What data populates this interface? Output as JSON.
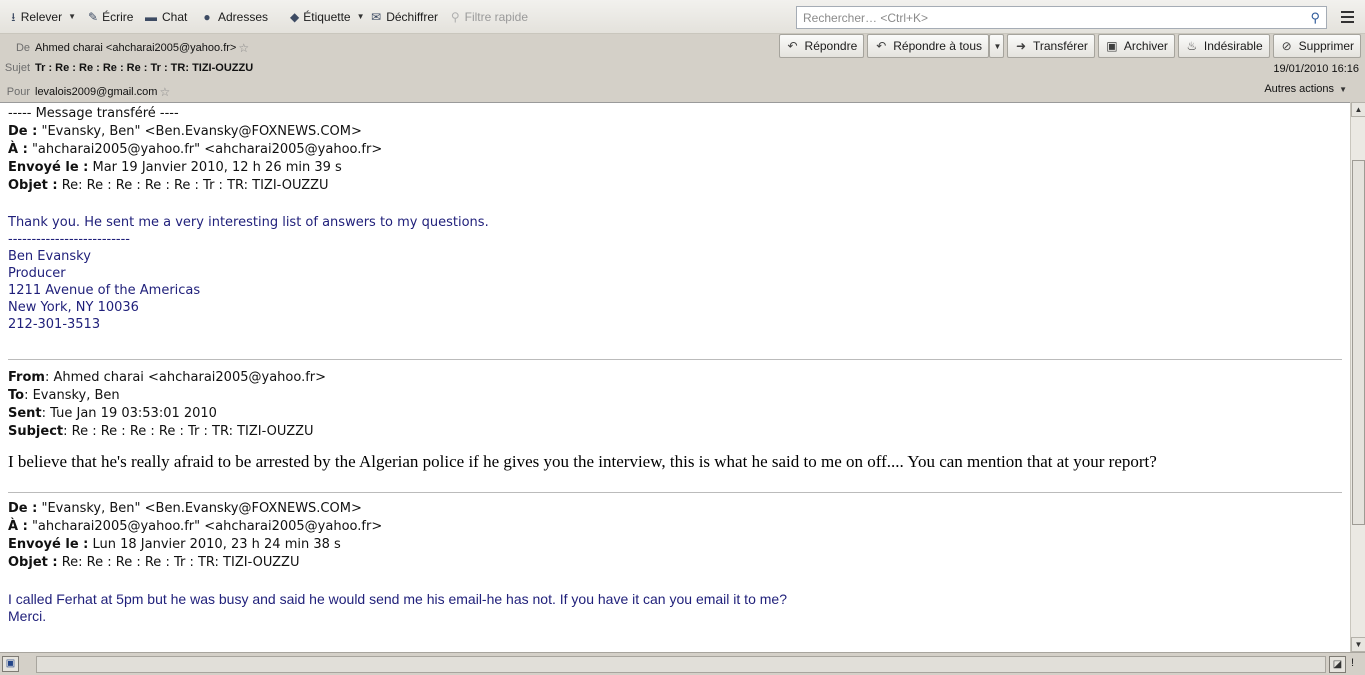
{
  "toolbar": {
    "relever": "Relever",
    "ecrire": "Écrire",
    "chat": "Chat",
    "adresses": "Adresses",
    "etiquette": "Étiquette",
    "dechiffrer": "Déchiffrer",
    "filtre": "Filtre rapide",
    "search_placeholder": "Rechercher… <Ctrl+K>"
  },
  "header": {
    "from_label": "De",
    "from_value": "Ahmed charai <ahcharai2005@yahoo.fr>",
    "subject_label": "Sujet",
    "subject_value": "Tr : Re : Re : Re : Re : Tr : TR: TIZI-OUZZU",
    "to_label": "Pour",
    "to_value": "levalois2009@gmail.com",
    "date": "19/01/2010 16:16",
    "other_actions": "Autres actions"
  },
  "actions": {
    "reply": "Répondre",
    "reply_all": "Répondre à tous",
    "forward": "Transférer",
    "archive": "Archiver",
    "junk": "Indésirable",
    "delete": "Supprimer"
  },
  "message": {
    "fwd_header": "----- Message transféré ----",
    "block1": {
      "de_label": "De :",
      "de_value": "\"Evansky, Ben\" <Ben.Evansky@FOXNEWS.COM>",
      "a_label": "À :",
      "a_value": "\"ahcharai2005@yahoo.fr\" <ahcharai2005@yahoo.fr>",
      "envoye_label": "Envoyé le :",
      "envoye_value": "Mar 19 Janvier 2010, 12 h 26 min 39 s",
      "objet_label": "Objet :",
      "objet_value": "Re: Re : Re : Re : Re : Tr : TR: TIZI-OUZZU"
    },
    "body1": "Thank you. He sent me a very interesting list of answers to my questions.",
    "sig_sep": "--------------------------",
    "signature": [
      "Ben Evansky",
      "Producer",
      "1211 Avenue of the Americas",
      "New York, NY 10036",
      "212-301-3513"
    ],
    "block2": {
      "from_label": "From",
      "from_value": ": Ahmed charai <ahcharai2005@yahoo.fr>",
      "to_label": "To",
      "to_value": ": Evansky, Ben",
      "sent_label": "Sent",
      "sent_value": ": Tue Jan 19 03:53:01 2010",
      "subject_label": "Subject",
      "subject_value": ": Re : Re : Re : Re : Tr : TR: TIZI-OUZZU"
    },
    "body2": "I believe that he's really afraid to be arrested by the Algerian police if he gives you the interview, this is what he said to me on off.... You can mention that at your report?",
    "block3": {
      "de_label": "De :",
      "de_value": "\"Evansky, Ben\" <Ben.Evansky@FOXNEWS.COM>",
      "a_label": "À :",
      "a_value": "\"ahcharai2005@yahoo.fr\" <ahcharai2005@yahoo.fr>",
      "envoye_label": "Envoyé le :",
      "envoye_value": "Lun 18 Janvier 2010, 23 h 24 min 38 s",
      "objet_label": "Objet :",
      "objet_value": "Re: Re : Re : Re : Tr : TR: TIZI-OUZZU"
    },
    "body3": "I called Ferhat at 5pm but he was busy and said he would send me his email-he has not. If you have it can you email it to me?",
    "body3b": "Merci."
  }
}
